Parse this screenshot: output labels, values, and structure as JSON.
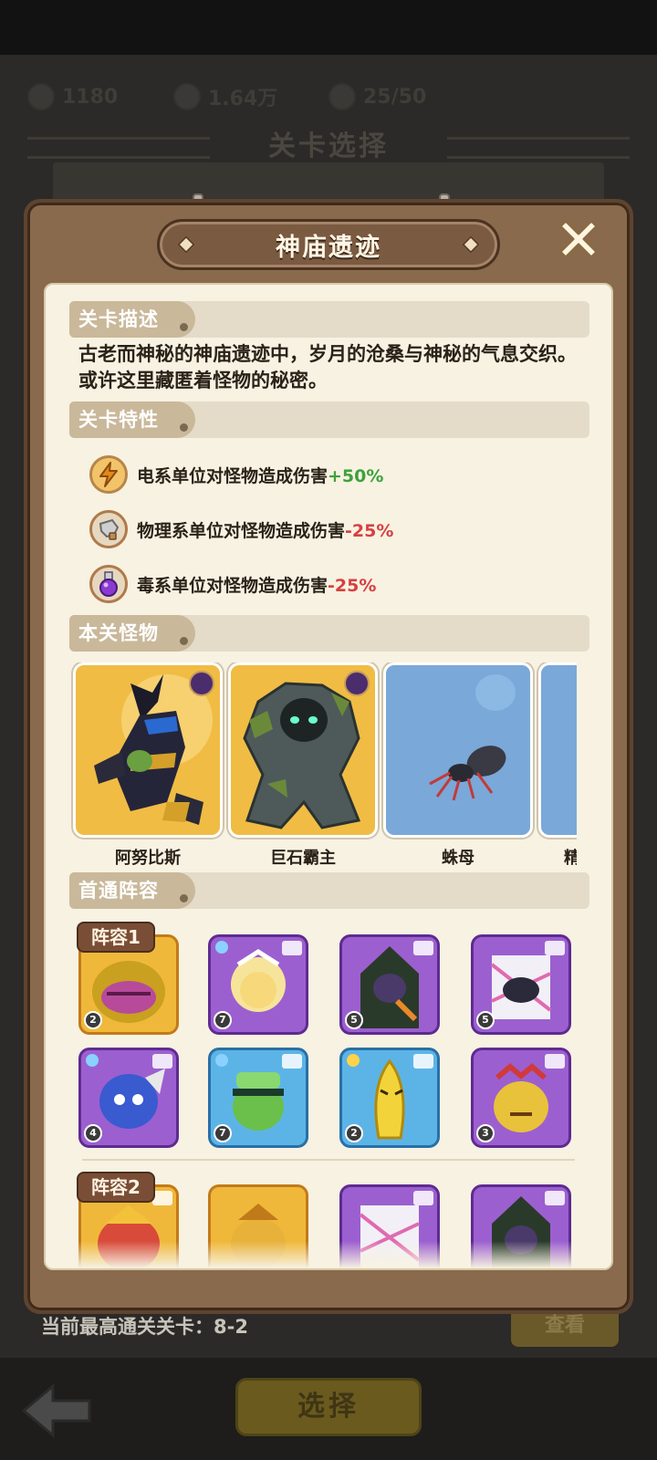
{
  "background": {
    "resources": [
      "1180",
      "1.64万",
      "25/50"
    ],
    "screen_title": "关卡选择",
    "best_stage_text": "当前最高通关关卡：8-2",
    "view_button": "查看",
    "select_button": "选择"
  },
  "modal": {
    "title": "神庙遗迹",
    "sections": {
      "description": "关卡描述",
      "traits": "关卡特性",
      "monsters": "本关怪物",
      "first_clear": "首通阵容"
    },
    "description_text": "古老而神秘的神庙遗迹中，岁月的沧桑与神秘的气息交织。或许这里藏匿着怪物的秘密。",
    "traits": [
      {
        "icon": "lightning-icon",
        "text": "电系单位对怪物造成伤害",
        "value": "+50%",
        "color": "#3ea13c"
      },
      {
        "icon": "fist-icon",
        "text": "物理系单位对怪物造成伤害",
        "value": "-25%",
        "color": "#d64040"
      },
      {
        "icon": "poison-flask-icon",
        "text": "毒系单位对怪物造成伤害",
        "value": "-25%",
        "color": "#d64040"
      }
    ],
    "monsters": [
      {
        "name": "阿努比斯",
        "boss": true
      },
      {
        "name": "巨石霸主",
        "boss": true
      },
      {
        "name": "蛛母",
        "boss": false
      },
      {
        "name": "精",
        "boss": false
      }
    ],
    "teams": [
      {
        "label": "阵容1",
        "heroes": [
          {
            "level": "2",
            "frame": "gold"
          },
          {
            "level": "7",
            "frame": "purple"
          },
          {
            "level": "5",
            "frame": "purple"
          },
          {
            "level": "5",
            "frame": "purple"
          },
          {
            "level": "4",
            "frame": "purple"
          },
          {
            "level": "7",
            "frame": "blue"
          },
          {
            "level": "2",
            "frame": "blue"
          },
          {
            "level": "3",
            "frame": "purple"
          }
        ]
      },
      {
        "label": "阵容2",
        "heroes": [
          {
            "frame": "gold"
          },
          {
            "frame": "gold"
          },
          {
            "frame": "purple"
          },
          {
            "frame": "purple"
          }
        ]
      }
    ]
  }
}
